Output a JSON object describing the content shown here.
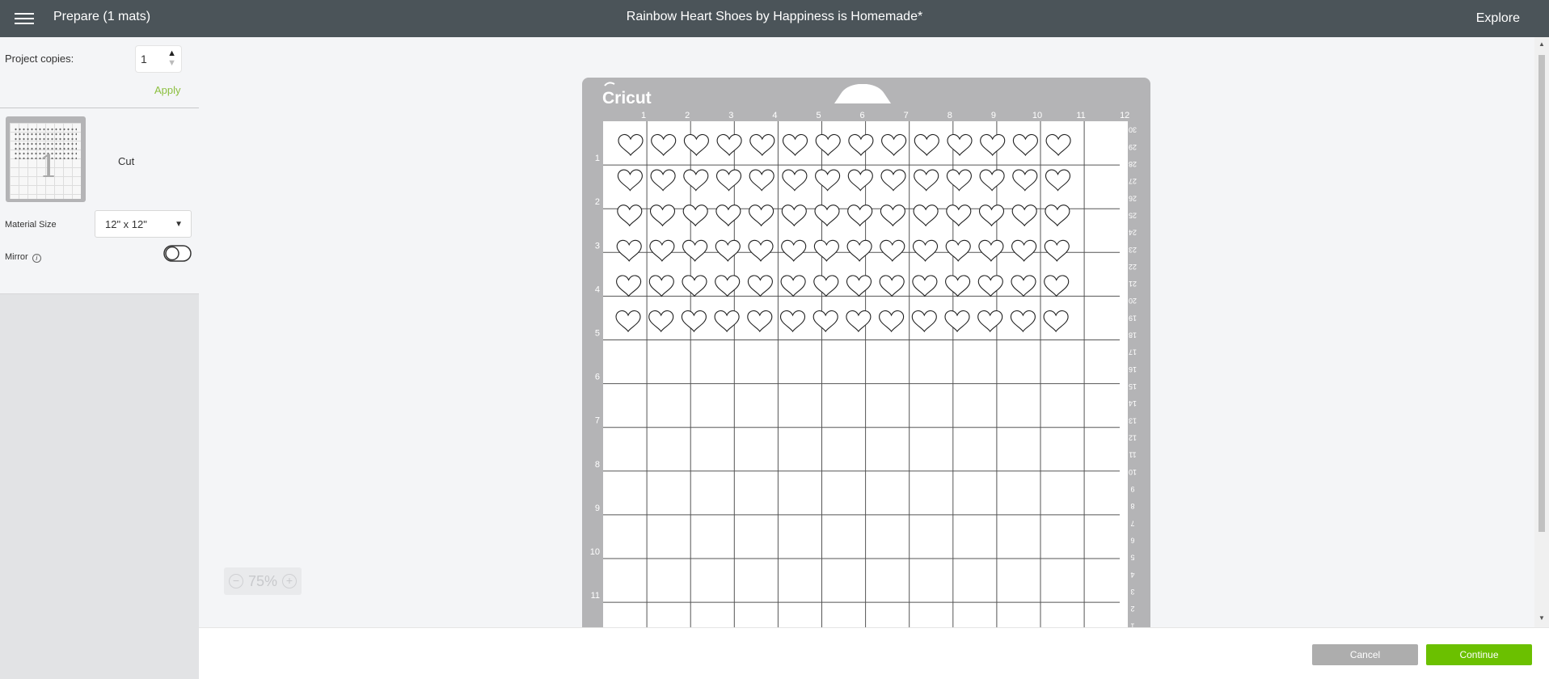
{
  "header": {
    "menu_icon": "hamburger-menu-icon",
    "prepare_title": "Prepare (1 mats)",
    "project_title": "Rainbow Heart Shoes by Happiness is Homemade*",
    "explore_label": "Explore"
  },
  "sidebar": {
    "copies_label": "Project copies:",
    "copies_value": "1",
    "apply_label": "Apply",
    "mat_label": "Cut",
    "mat_thumbnail_number": "1",
    "material_size_label": "Material Size",
    "material_size_value": "12\" x 12\"",
    "mirror_label": "Mirror",
    "mirror_on": false
  },
  "mat": {
    "brand": "Cricut",
    "top_ruler": [
      "1",
      "2",
      "3",
      "4",
      "5",
      "6",
      "7",
      "8",
      "9",
      "10",
      "11",
      "12"
    ],
    "left_ruler": [
      "1",
      "2",
      "3",
      "4",
      "5",
      "6",
      "7",
      "8",
      "9",
      "10",
      "11"
    ],
    "right_ruler": [
      "30",
      "29",
      "28",
      "27",
      "26",
      "25",
      "24",
      "23",
      "22",
      "21",
      "20",
      "19",
      "18",
      "17",
      "16",
      "15",
      "14",
      "13",
      "12",
      "11",
      "10",
      "9",
      "8",
      "7",
      "6",
      "5",
      "4",
      "3",
      "2",
      "1"
    ],
    "heart_rows": 6,
    "heart_cols": 14
  },
  "zoom": {
    "value": "75%"
  },
  "footer": {
    "cancel_label": "Cancel",
    "continue_label": "Continue"
  },
  "colors": {
    "topbar": "#4b5459",
    "accent_green": "#6bc000",
    "apply_green": "#8cbf3f",
    "mat_gray": "#b4b4b6"
  }
}
